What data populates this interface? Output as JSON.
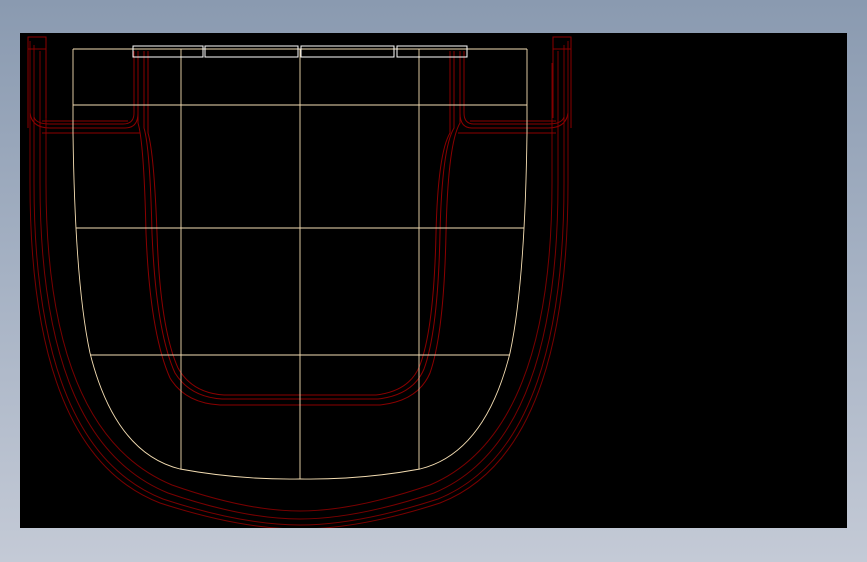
{
  "drawing": {
    "background_color": "#000000",
    "grid_line_color": "#f5deb3",
    "outline_color": "#8b0000",
    "outline_color_light": "#b22222",
    "rim_top_color": "#ffffff"
  }
}
